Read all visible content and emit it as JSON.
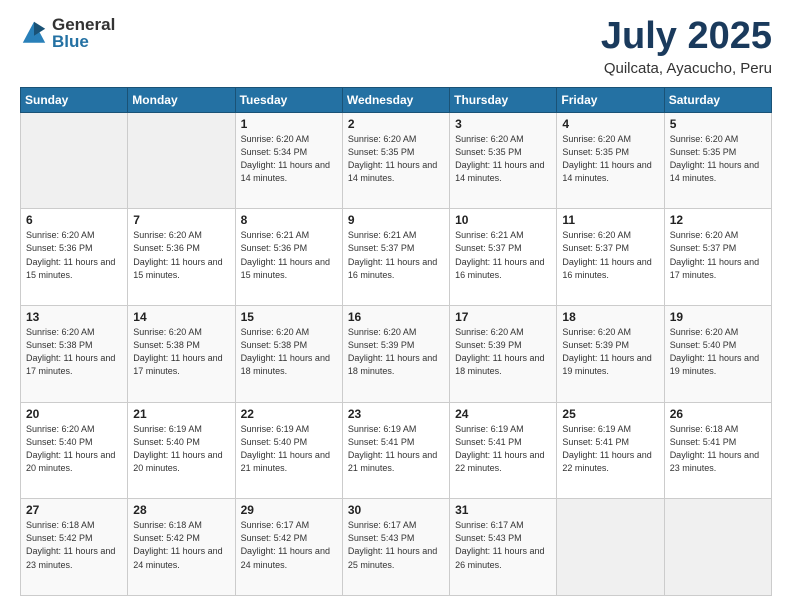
{
  "header": {
    "title": "July 2025",
    "subtitle": "Quilcata, Ayacucho, Peru"
  },
  "weekdays": [
    "Sunday",
    "Monday",
    "Tuesday",
    "Wednesday",
    "Thursday",
    "Friday",
    "Saturday"
  ],
  "weeks": [
    [
      null,
      null,
      {
        "day": 1,
        "sunrise": "6:20 AM",
        "sunset": "5:34 PM",
        "daylight": "11 hours and 14 minutes."
      },
      {
        "day": 2,
        "sunrise": "6:20 AM",
        "sunset": "5:35 PM",
        "daylight": "11 hours and 14 minutes."
      },
      {
        "day": 3,
        "sunrise": "6:20 AM",
        "sunset": "5:35 PM",
        "daylight": "11 hours and 14 minutes."
      },
      {
        "day": 4,
        "sunrise": "6:20 AM",
        "sunset": "5:35 PM",
        "daylight": "11 hours and 14 minutes."
      },
      {
        "day": 5,
        "sunrise": "6:20 AM",
        "sunset": "5:35 PM",
        "daylight": "11 hours and 14 minutes."
      }
    ],
    [
      {
        "day": 6,
        "sunrise": "6:20 AM",
        "sunset": "5:36 PM",
        "daylight": "11 hours and 15 minutes."
      },
      {
        "day": 7,
        "sunrise": "6:20 AM",
        "sunset": "5:36 PM",
        "daylight": "11 hours and 15 minutes."
      },
      {
        "day": 8,
        "sunrise": "6:21 AM",
        "sunset": "5:36 PM",
        "daylight": "11 hours and 15 minutes."
      },
      {
        "day": 9,
        "sunrise": "6:21 AM",
        "sunset": "5:37 PM",
        "daylight": "11 hours and 16 minutes."
      },
      {
        "day": 10,
        "sunrise": "6:21 AM",
        "sunset": "5:37 PM",
        "daylight": "11 hours and 16 minutes."
      },
      {
        "day": 11,
        "sunrise": "6:20 AM",
        "sunset": "5:37 PM",
        "daylight": "11 hours and 16 minutes."
      },
      {
        "day": 12,
        "sunrise": "6:20 AM",
        "sunset": "5:37 PM",
        "daylight": "11 hours and 17 minutes."
      }
    ],
    [
      {
        "day": 13,
        "sunrise": "6:20 AM",
        "sunset": "5:38 PM",
        "daylight": "11 hours and 17 minutes."
      },
      {
        "day": 14,
        "sunrise": "6:20 AM",
        "sunset": "5:38 PM",
        "daylight": "11 hours and 17 minutes."
      },
      {
        "day": 15,
        "sunrise": "6:20 AM",
        "sunset": "5:38 PM",
        "daylight": "11 hours and 18 minutes."
      },
      {
        "day": 16,
        "sunrise": "6:20 AM",
        "sunset": "5:39 PM",
        "daylight": "11 hours and 18 minutes."
      },
      {
        "day": 17,
        "sunrise": "6:20 AM",
        "sunset": "5:39 PM",
        "daylight": "11 hours and 18 minutes."
      },
      {
        "day": 18,
        "sunrise": "6:20 AM",
        "sunset": "5:39 PM",
        "daylight": "11 hours and 19 minutes."
      },
      {
        "day": 19,
        "sunrise": "6:20 AM",
        "sunset": "5:40 PM",
        "daylight": "11 hours and 19 minutes."
      }
    ],
    [
      {
        "day": 20,
        "sunrise": "6:20 AM",
        "sunset": "5:40 PM",
        "daylight": "11 hours and 20 minutes."
      },
      {
        "day": 21,
        "sunrise": "6:19 AM",
        "sunset": "5:40 PM",
        "daylight": "11 hours and 20 minutes."
      },
      {
        "day": 22,
        "sunrise": "6:19 AM",
        "sunset": "5:40 PM",
        "daylight": "11 hours and 21 minutes."
      },
      {
        "day": 23,
        "sunrise": "6:19 AM",
        "sunset": "5:41 PM",
        "daylight": "11 hours and 21 minutes."
      },
      {
        "day": 24,
        "sunrise": "6:19 AM",
        "sunset": "5:41 PM",
        "daylight": "11 hours and 22 minutes."
      },
      {
        "day": 25,
        "sunrise": "6:19 AM",
        "sunset": "5:41 PM",
        "daylight": "11 hours and 22 minutes."
      },
      {
        "day": 26,
        "sunrise": "6:18 AM",
        "sunset": "5:41 PM",
        "daylight": "11 hours and 23 minutes."
      }
    ],
    [
      {
        "day": 27,
        "sunrise": "6:18 AM",
        "sunset": "5:42 PM",
        "daylight": "11 hours and 23 minutes."
      },
      {
        "day": 28,
        "sunrise": "6:18 AM",
        "sunset": "5:42 PM",
        "daylight": "11 hours and 24 minutes."
      },
      {
        "day": 29,
        "sunrise": "6:17 AM",
        "sunset": "5:42 PM",
        "daylight": "11 hours and 24 minutes."
      },
      {
        "day": 30,
        "sunrise": "6:17 AM",
        "sunset": "5:43 PM",
        "daylight": "11 hours and 25 minutes."
      },
      {
        "day": 31,
        "sunrise": "6:17 AM",
        "sunset": "5:43 PM",
        "daylight": "11 hours and 26 minutes."
      },
      null,
      null
    ]
  ]
}
